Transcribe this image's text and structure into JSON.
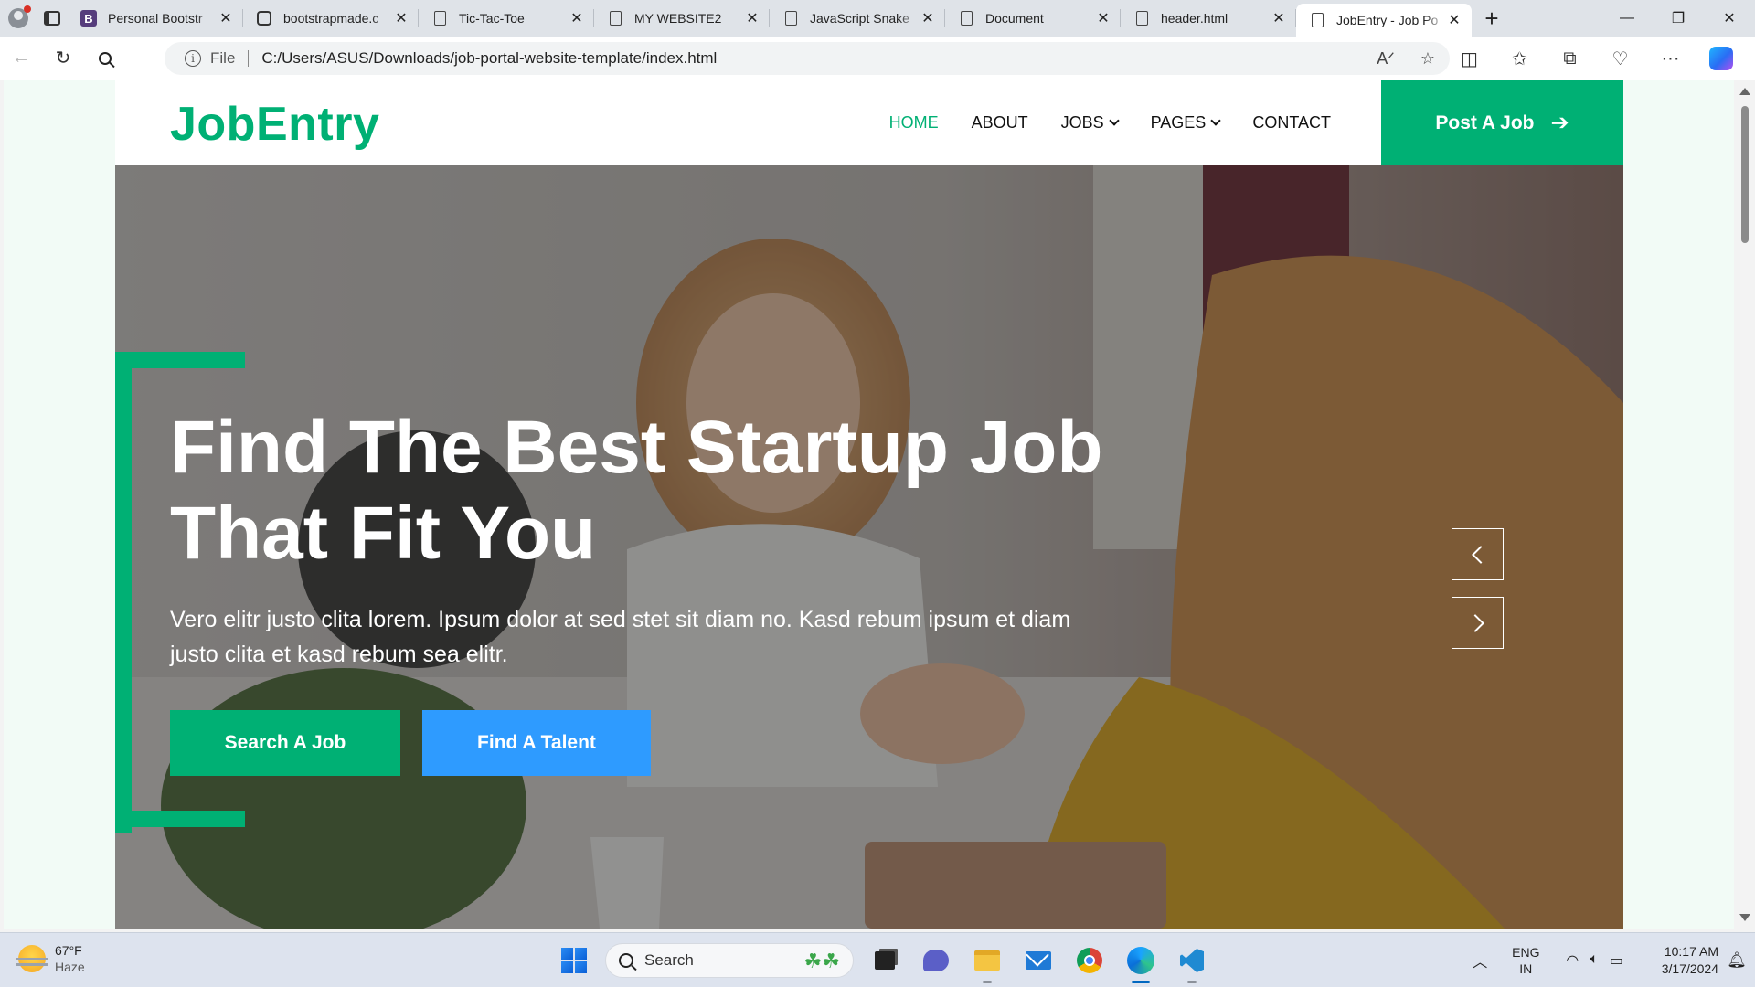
{
  "browser": {
    "tabs": [
      {
        "title": "Personal Bootstr",
        "favicon": "bootstrap-icon"
      },
      {
        "title": "bootstrapmade.c",
        "favicon": "bootstrapmade-icon"
      },
      {
        "title": "Tic-Tac-Toe",
        "favicon": "document-icon"
      },
      {
        "title": "MY WEBSITE2",
        "favicon": "document-icon"
      },
      {
        "title": "JavaScript Snake",
        "favicon": "document-icon"
      },
      {
        "title": "Document",
        "favicon": "document-icon"
      },
      {
        "title": "header.html",
        "favicon": "document-icon"
      },
      {
        "title": "JobEntry - Job Po",
        "favicon": "document-icon",
        "active": true
      }
    ],
    "address": {
      "scheme_label": "File",
      "url": "C:/Users/ASUS/Downloads/job-portal-website-template/index.html"
    }
  },
  "site": {
    "brand": "JobEntry",
    "nav": [
      {
        "label": "HOME",
        "active": true,
        "dropdown": false
      },
      {
        "label": "ABOUT",
        "active": false,
        "dropdown": false
      },
      {
        "label": "JOBS",
        "active": false,
        "dropdown": true
      },
      {
        "label": "PAGES",
        "active": false,
        "dropdown": true
      },
      {
        "label": "CONTACT",
        "active": false,
        "dropdown": false
      }
    ],
    "post_job": "Post A Job",
    "hero": {
      "headline_1": "Find The Best Startup Job",
      "headline_2": "That Fit You",
      "lead": "Vero elitr justo clita lorem. Ipsum dolor at sed stet sit diam no. Kasd rebum ipsum et diam justo clita et kasd rebum sea elitr.",
      "cta_primary": "Search A Job",
      "cta_secondary": "Find A Talent"
    },
    "colors": {
      "primary": "#00b074",
      "secondary": "#2e9bff"
    }
  },
  "taskbar": {
    "weather": {
      "temp": "67°F",
      "condition": "Haze"
    },
    "search_placeholder": "Search",
    "language": {
      "line1": "ENG",
      "line2": "IN"
    },
    "time": "10:17 AM",
    "date": "3/17/2024"
  }
}
